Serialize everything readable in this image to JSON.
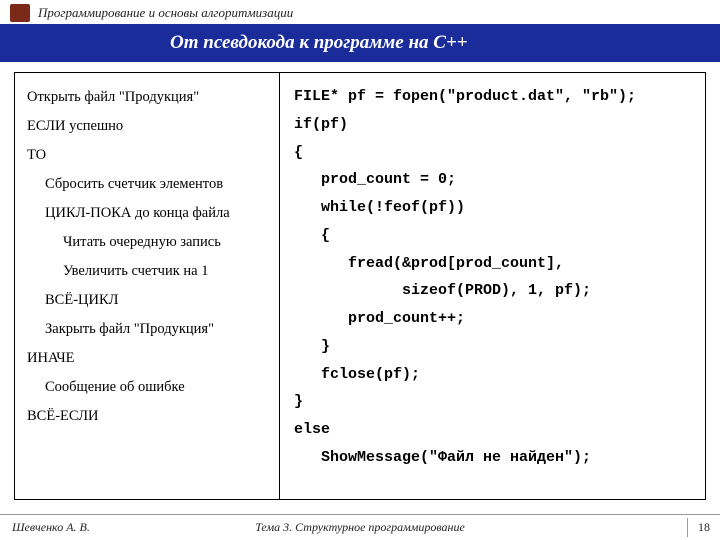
{
  "header": {
    "course": "Программирование и основы алгоритмизации",
    "icon": "book-icon"
  },
  "title": "От псевдокода к программе на С++",
  "pseudocode": [
    {
      "text": "Открыть файл \"Продукция\"",
      "indent": 0
    },
    {
      "text": "ЕСЛИ успешно",
      "indent": 0
    },
    {
      "text": "ТО",
      "indent": 0
    },
    {
      "text": "Сбросить счетчик элементов",
      "indent": 1
    },
    {
      "text": "ЦИКЛ-ПОКА до конца файла",
      "indent": 1
    },
    {
      "text": "Читать очередную запись",
      "indent": 2
    },
    {
      "text": "Увеличить счетчик на 1",
      "indent": 2
    },
    {
      "text": "ВСЁ-ЦИКЛ",
      "indent": 1
    },
    {
      "text": "Закрыть файл \"Продукция\"",
      "indent": 1
    },
    {
      "text": "ИНАЧЕ",
      "indent": 0
    },
    {
      "text": "Сообщение об ошибке",
      "indent": 1
    },
    {
      "text": "ВСЁ-ЕСЛИ",
      "indent": 0
    }
  ],
  "code": "FILE* pf = fopen(\"product.dat\", \"rb\");\nif(pf)\n{\n   prod_count = 0;\n   while(!feof(pf))\n   {\n      fread(&prod[prod_count],\n            sizeof(PROD), 1, pf);\n      prod_count++;\n   }\n   fclose(pf);\n}\nelse\n   ShowMessage(\"Файл не найден\");",
  "footer": {
    "author": "Шевченко А. В.",
    "topic": "Тема 3. Структурное программирование",
    "page": "18"
  }
}
